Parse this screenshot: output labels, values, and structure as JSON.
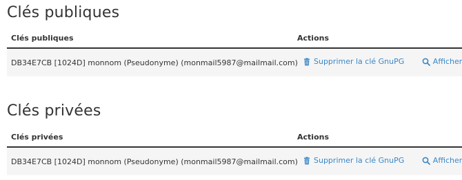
{
  "public_keys": {
    "title": "Clés publiques",
    "headers": {
      "key": "Clés publiques",
      "actions": "Actions"
    },
    "rows": [
      {
        "key": "DB34E7CB [1024D] monnom (Pseudonyme) (monmail5987@mailmail.com)",
        "delete_label": "Supprimer la clé GnuPG",
        "show_label": "Afficher"
      }
    ]
  },
  "private_keys": {
    "title": "Clés privées",
    "headers": {
      "key": "Clés privées",
      "actions": "Actions"
    },
    "rows": [
      {
        "key": "DB34E7CB [1024D] monnom (Pseudonyme) (monmail5987@mailmail.com)",
        "delete_label": "Supprimer la clé GnuPG",
        "show_label": "Afficher"
      }
    ]
  },
  "icons": {
    "delete": "trash-icon",
    "show": "search-icon"
  },
  "colors": {
    "link": "#3a87c7",
    "row_background": "#f5f5f5",
    "text": "#333333"
  }
}
